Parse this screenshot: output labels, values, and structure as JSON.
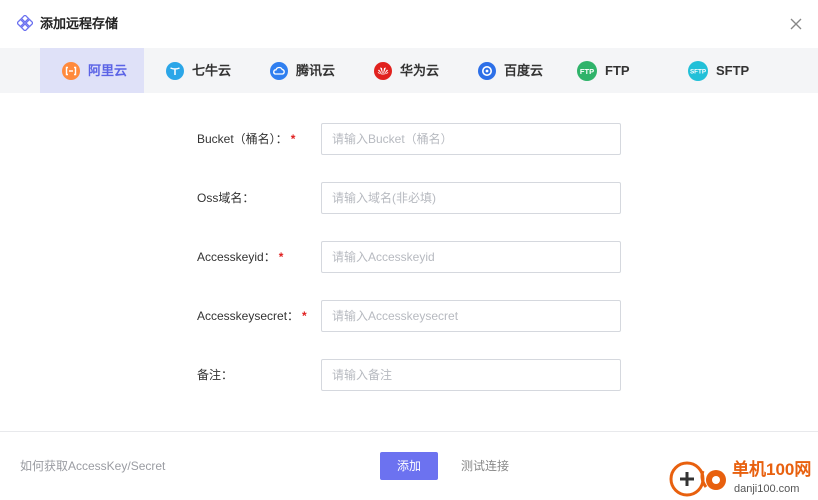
{
  "dialog": {
    "title": "添加远程存储",
    "close_icon": "close-icon",
    "title_icon": "cluster-diamond-icon"
  },
  "tabs": [
    {
      "label": "阿里云",
      "icon": "aliyun-icon",
      "color": "#ff8a3d",
      "active": true
    },
    {
      "label": "七牛云",
      "icon": "qiniu-icon",
      "color": "#2ba6e8",
      "active": false
    },
    {
      "label": "腾讯云",
      "icon": "tencent-cloud-icon",
      "color": "#2f7ff0",
      "active": false
    },
    {
      "label": "华为云",
      "icon": "huawei-icon",
      "color": "#e1211e",
      "active": false
    },
    {
      "label": "百度云",
      "icon": "baidu-cloud-icon",
      "color": "#2c6fe8",
      "active": false
    },
    {
      "label": "FTP",
      "icon": "ftp-icon",
      "icon_text": "FTP",
      "color": "#2fb36a",
      "active": false
    },
    {
      "label": "SFTP",
      "icon": "sftp-icon",
      "icon_text": "SFTP",
      "color": "#22c0d8",
      "active": false
    }
  ],
  "form": {
    "fields": [
      {
        "label": "Bucket（桶名）：",
        "required": "*",
        "placeholder": "请输入Bucket（桶名）",
        "value": ""
      },
      {
        "label": "Oss域名：",
        "required": "",
        "placeholder": "请输入域名(非必填)",
        "value": ""
      },
      {
        "label": "Accesskeyid：",
        "required": "*",
        "placeholder": "请输入Accesskeyid",
        "value": ""
      },
      {
        "label": "Accesskeysecret：",
        "required": "*",
        "placeholder": "请输入Accesskeysecret",
        "value": ""
      },
      {
        "label": "备注：",
        "required": "",
        "placeholder": "请输入备注",
        "value": ""
      }
    ]
  },
  "footer": {
    "help_link": "如何获取AccessKey/Secret",
    "add_label": "添加",
    "test_label": "测试连接"
  },
  "watermark": {
    "name": "单机100网",
    "url": "danji100.com"
  },
  "colors": {
    "accent": "#6c72f0",
    "active_tab_bg": "#dfe1f8",
    "active_tab_text": "#5b63e6",
    "required": "#e02020"
  }
}
